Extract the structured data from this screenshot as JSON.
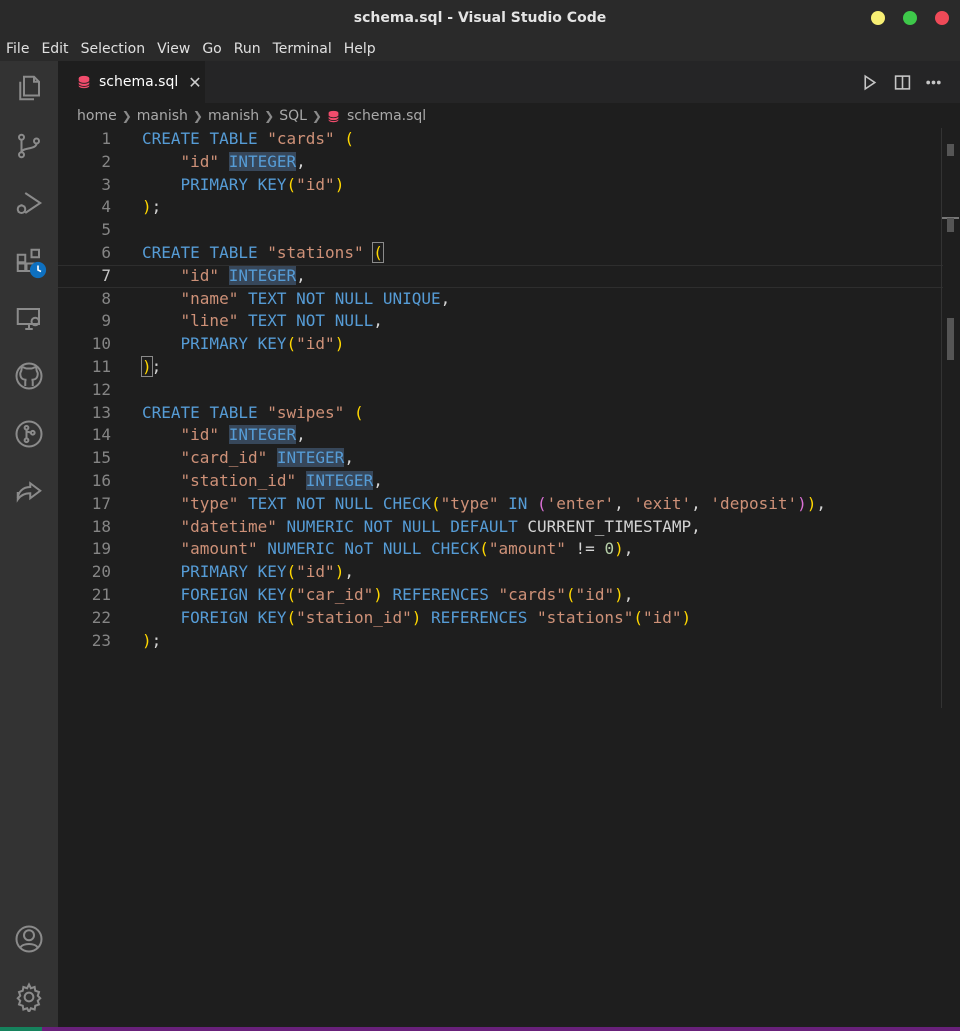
{
  "window": {
    "title": "schema.sql - Visual Studio Code",
    "controls": {
      "minimize_color": "#f7ef74",
      "maximize_color": "#3ec84a",
      "close_color": "#ef4a58"
    }
  },
  "menu": [
    "File",
    "Edit",
    "Selection",
    "View",
    "Go",
    "Run",
    "Terminal",
    "Help"
  ],
  "activity_bar": {
    "icons": [
      "files-icon",
      "source-control-icon",
      "run-debug-icon",
      "extensions-icon",
      "remote-explorer-icon",
      "github-icon",
      "git-graph-icon",
      "live-share-icon",
      "accounts-icon",
      "settings-gear-icon"
    ]
  },
  "tab": {
    "label": "schema.sql",
    "close": "✕",
    "icon": "database-icon"
  },
  "breadcrumb": [
    "home",
    "manish",
    "manish",
    "SQL",
    "schema.sql"
  ],
  "editor": {
    "current_line": 7,
    "lines": [
      {
        "n": "1",
        "text": "CREATE TABLE \"cards\" ("
      },
      {
        "n": "2",
        "text": "    \"id\" INTEGER,"
      },
      {
        "n": "3",
        "text": "    PRIMARY KEY(\"id\")"
      },
      {
        "n": "4",
        "text": ");"
      },
      {
        "n": "5",
        "text": ""
      },
      {
        "n": "6",
        "text": "CREATE TABLE \"stations\" ("
      },
      {
        "n": "7",
        "text": "    \"id\" INTEGER,"
      },
      {
        "n": "8",
        "text": "    \"name\" TEXT NOT NULL UNIQUE,"
      },
      {
        "n": "9",
        "text": "    \"line\" TEXT NOT NULL,"
      },
      {
        "n": "10",
        "text": "    PRIMARY KEY(\"id\")"
      },
      {
        "n": "11",
        "text": ");"
      },
      {
        "n": "12",
        "text": ""
      },
      {
        "n": "13",
        "text": "CREATE TABLE \"swipes\" ("
      },
      {
        "n": "14",
        "text": "    \"id\" INTEGER,"
      },
      {
        "n": "15",
        "text": "    \"card_id\" INTEGER,"
      },
      {
        "n": "16",
        "text": "    \"station_id\" INTEGER,"
      },
      {
        "n": "17",
        "text": "    \"type\" TEXT NOT NULL CHECK(\"type\" IN ('enter', 'exit', 'deposit')),"
      },
      {
        "n": "18",
        "text": "    \"datetime\" NUMERIC NOT NULL DEFAULT CURRENT_TIMESTAMP,"
      },
      {
        "n": "19",
        "text": "    \"amount\" NUMERIC NoT NULL CHECK(\"amount\" != 0),"
      },
      {
        "n": "20",
        "text": "    PRIMARY KEY(\"id\"),"
      },
      {
        "n": "21",
        "text": "    FOREIGN KEY(\"car_id\") REFERENCES \"cards\"(\"id\"),"
      },
      {
        "n": "22",
        "text": "    FOREIGN KEY(\"station_id\") REFERENCES \"stations\"(\"id\")"
      },
      {
        "n": "23",
        "text": ");"
      }
    ]
  },
  "colors": {
    "keyword": "#569cd6",
    "string": "#ce9178",
    "bracket": "#ffd700",
    "bracket2": "#da70d6",
    "number": "#b5cea8",
    "selection_highlight": "#37475a",
    "status_bar": "#68217a",
    "remote_indicator": "#16825d"
  }
}
